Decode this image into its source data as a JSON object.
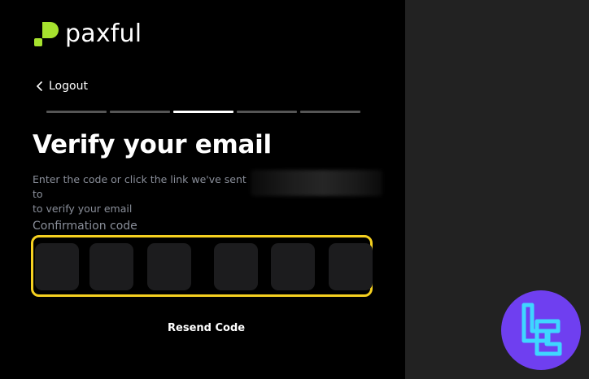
{
  "brand": {
    "name": "paxful",
    "accent": "#a6e22e"
  },
  "nav": {
    "logout_label": "Logout"
  },
  "progress": {
    "total_steps": 5,
    "current_step": 3
  },
  "page": {
    "title": "Verify your email",
    "description_line1": "Enter the code or click the link we've sent to",
    "description_line2": "to verify your email"
  },
  "form": {
    "code_label": "Confirmation code",
    "code_digits": [
      "",
      "",
      "",
      "",
      "",
      ""
    ],
    "focus_color": "#f5d020",
    "resend_label": "Resend Code"
  },
  "watermark": {
    "icon": "tradingfinder-logo-icon",
    "color": "#6f3ff0"
  }
}
